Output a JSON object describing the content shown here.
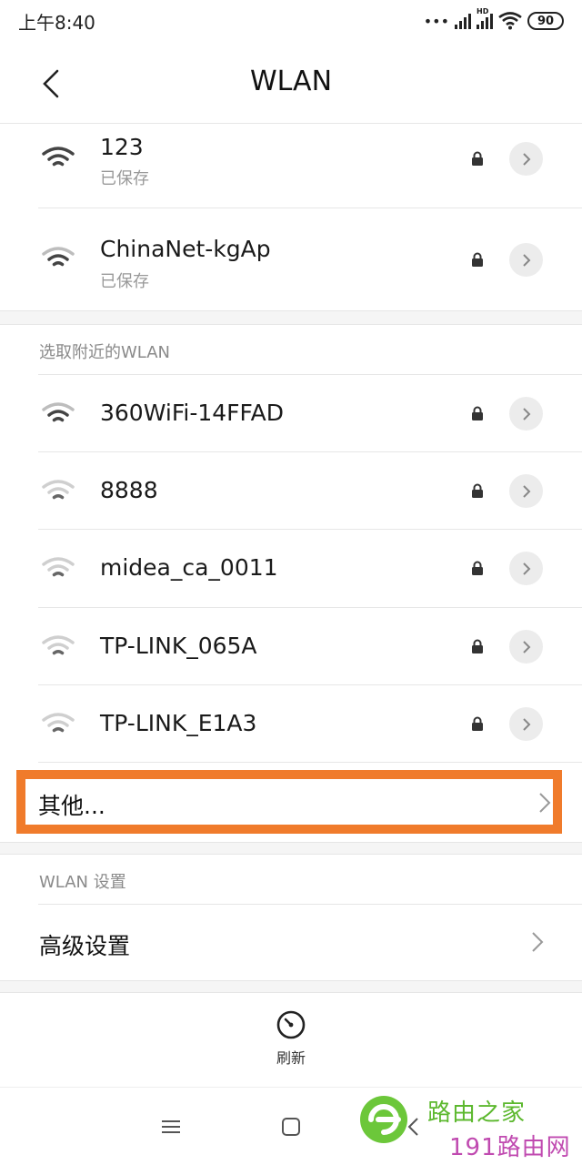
{
  "status_bar": {
    "time": "上午8:40",
    "battery": "90",
    "network_badge": "HD"
  },
  "header": {
    "title": "WLAN",
    "back_icon": "back-arrow-icon"
  },
  "saved_networks": [
    {
      "name": "123",
      "status": "已保存",
      "secured": true,
      "signal": "full"
    },
    {
      "name": "ChinaNet-kgAp",
      "status": "已保存",
      "secured": true,
      "signal": "medium"
    }
  ],
  "nearby": {
    "header": "选取附近的WLAN",
    "networks": [
      {
        "name": "360WiFi-14FFAD",
        "secured": true,
        "signal": "medium"
      },
      {
        "name": "8888",
        "secured": true,
        "signal": "weak"
      },
      {
        "name": "midea_ca_0011",
        "secured": true,
        "signal": "weak"
      },
      {
        "name": "TP-LINK_065A",
        "secured": true,
        "signal": "weak"
      },
      {
        "name": "TP-LINK_E1A3",
        "secured": true,
        "signal": "weak"
      }
    ],
    "other_label": "其他..."
  },
  "settings": {
    "header": "WLAN 设置",
    "advanced_label": "高级设置"
  },
  "action_bar": {
    "refresh_label": "刷新"
  },
  "watermark": {
    "line1": "路由之家",
    "line2": "191路由网"
  },
  "colors": {
    "highlight": "#f07b2b",
    "watermark_green": "#5cb82e",
    "watermark_purple": "#c04ab0"
  }
}
